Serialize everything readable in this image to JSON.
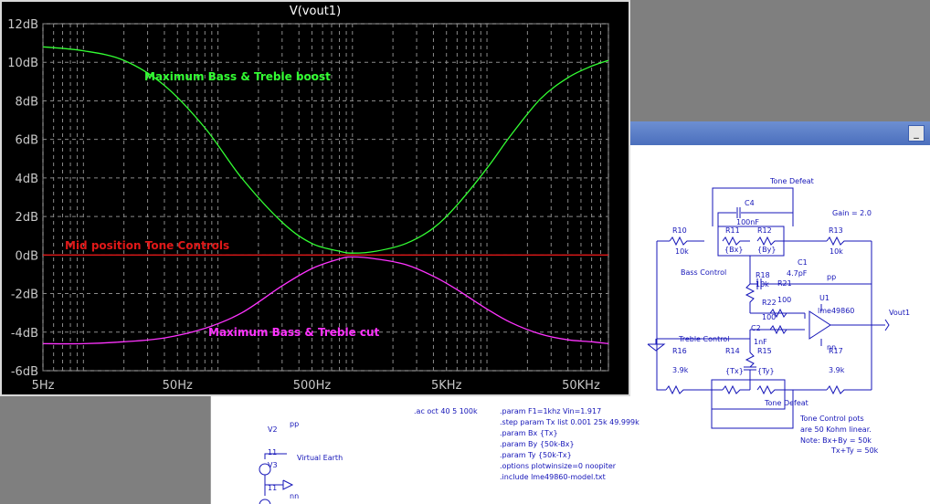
{
  "plot": {
    "title": "V(vout1)",
    "y_ticks": [
      "12dB",
      "10dB",
      "8dB",
      "6dB",
      "4dB",
      "2dB",
      "0dB",
      "-2dB",
      "-4dB",
      "-6dB"
    ],
    "x_ticks": [
      "5Hz",
      "50Hz",
      "500Hz",
      "5KHz",
      "50KHz"
    ],
    "annotations": {
      "boost": "Maximum Bass & Treble boost",
      "mid": "Mid position Tone Controls",
      "cut": "Maximum Bass & Treble cut"
    },
    "colors": {
      "boost": "#33ff33",
      "mid": "#e01818",
      "cut": "#ff33ff",
      "grid": "#8a8a8a"
    }
  },
  "chart_data": {
    "type": "line",
    "title": "V(vout1)",
    "x_scale": "log",
    "xlim": [
      5,
      80000
    ],
    "ylim": [
      -6,
      12
    ],
    "grid": true,
    "x": [
      5,
      10,
      20,
      40,
      80,
      150,
      300,
      500,
      800,
      1000,
      1500,
      2500,
      4000,
      6000,
      10000,
      15000,
      25000,
      40000,
      60000,
      80000
    ],
    "series": [
      {
        "name": "Maximum Bass & Treble boost",
        "values": [
          10.8,
          10.6,
          10.1,
          8.8,
          6.6,
          4.0,
          1.7,
          0.6,
          0.2,
          0.1,
          0.2,
          0.6,
          1.4,
          2.6,
          4.5,
          6.2,
          8.1,
          9.2,
          9.8,
          10.1
        ]
      },
      {
        "name": "Mid position Tone Controls",
        "values": [
          0,
          0,
          0,
          0,
          0,
          0,
          0,
          0,
          0,
          0,
          0,
          0,
          0,
          0,
          0,
          0,
          0,
          0,
          0,
          0
        ]
      },
      {
        "name": "Maximum Bass & Treble cut",
        "values": [
          -4.6,
          -4.6,
          -4.5,
          -4.3,
          -3.8,
          -3.0,
          -1.6,
          -0.7,
          -0.2,
          -0.1,
          -0.2,
          -0.5,
          -1.1,
          -1.8,
          -2.8,
          -3.5,
          -4.1,
          -4.4,
          -4.5,
          -4.6
        ]
      }
    ]
  },
  "schematic": {
    "labels": {
      "tone_defeat_top": "Tone Defeat",
      "tone_defeat_bottom": "Tone Defeat",
      "gain": "Gain = 2.0",
      "bass_control": "Bass Control",
      "treble_control": "Treble Control",
      "c4": "C4",
      "c4v": "100nF",
      "r10": "R10",
      "r10v": "10k",
      "r11": "R11",
      "r11v": "{Bx}",
      "r12": "R12",
      "r12v": "{By}",
      "r13": "R13",
      "r13v": "10k",
      "c1": "C1",
      "c1v": "4.7pF",
      "r18": "R18",
      "r18v": "10k",
      "r21": "R21",
      "r21v": "100",
      "r22": "R22",
      "r22v": "100",
      "u1": "U1",
      "u1v": "lme49860",
      "pp": "pp",
      "nn": "nn",
      "vout": "Vout1",
      "c2": "C2",
      "c2v": "1nF",
      "r16": "R16",
      "r16v": "3.9k",
      "r14": "R14",
      "r14v": "{Tx}",
      "r15": "R15",
      "r15v": "{Ty}",
      "r17": "R17",
      "r17v": "3.9k",
      "v2": "V2",
      "v2v": "11",
      "v3": "V3",
      "v3v": "11",
      "virtual_earth": "Virtual Earth",
      "pp2": "pp",
      "nn2": "nn"
    },
    "directives": [
      ".ac oct 40 5 100k",
      ".param  F1=1khz  Vin=1.917",
      ".step param  Tx  list     0.001     25k     49.999k",
      ".param  Bx  {Tx}",
      ".param  By  {50k-Bx}",
      ".param  Ty  {50k-Tx}",
      ".options plotwinsize=0  noopiter",
      ".include lme49860-model.txt"
    ],
    "note": [
      "Tone Control pots",
      "are 50 Kohm linear.",
      "Note:  Bx+By = 50k",
      "Tx+Ty = 50k"
    ]
  }
}
